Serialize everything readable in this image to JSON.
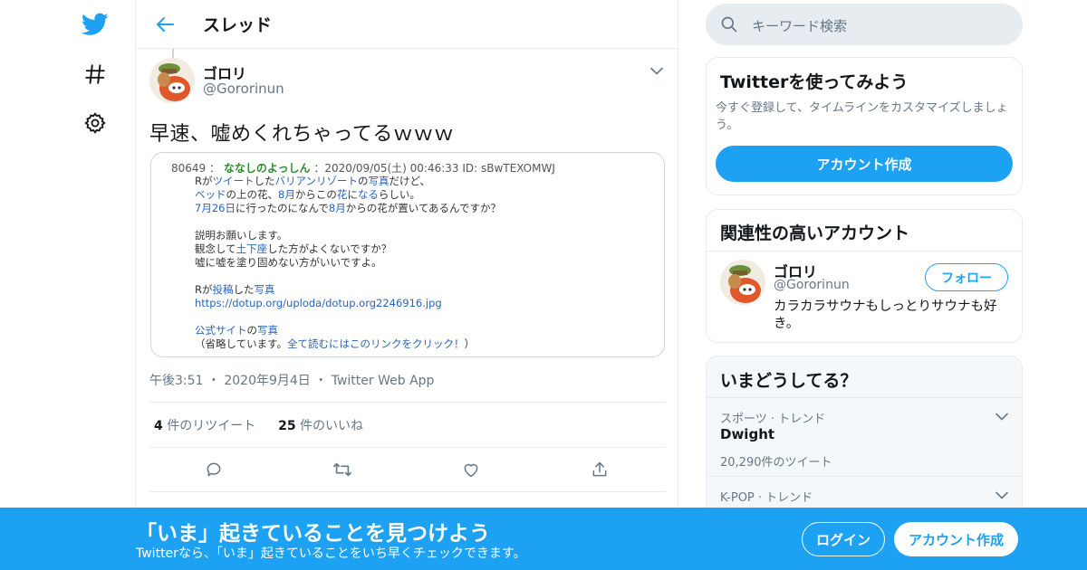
{
  "colors": {
    "accent": "#1da1f2",
    "text": "#14171a",
    "muted": "#657786",
    "border": "#e6ecf0",
    "link": "#2a64b8",
    "name_green": "#2e8b2e"
  },
  "nav": {
    "icons": [
      "twitter-bird-icon",
      "hashtag-icon",
      "gear-icon"
    ]
  },
  "header": {
    "title": "スレッド"
  },
  "tweet": {
    "author_name": "ゴロリ",
    "author_handle": "@Gororinun",
    "text": "早速、嘘めくれちゃってるｗｗｗ",
    "media": {
      "head_no": "80649 ：",
      "head_name": "ななしのよっしん",
      "head_meta": "：2020/09/05(土) 00:46:33 ID: sBwTEXOMWJ",
      "lines": [
        [
          "Rが",
          "ツイート",
          "した",
          "バリアンリゾート",
          "の",
          "写真",
          "だけど、"
        ],
        [
          "ベッド",
          "の上の花、",
          "8月",
          "からこの",
          "花",
          "に",
          "なる",
          "らしい。"
        ],
        [
          "7月26日",
          "に行ったのになんで",
          "8月",
          "からの花が置いてあるんですか？"
        ],
        [
          "説明お願いします。"
        ],
        [
          "観念して",
          "土下座",
          "した方がよくないですか？"
        ],
        [
          "嘘に嘘を塗り固めない方がいいですよ。"
        ],
        [
          "Rが",
          "投稿",
          "した",
          "写真"
        ],
        [
          "https://dotup.org/uploda/dotup.org2246916.jpg"
        ],
        [
          "公式サイト",
          "の",
          "写真"
        ],
        [
          "（省略しています。",
          "全て読むにはこのリンクをクリック！",
          "）"
        ]
      ]
    },
    "time": "午後3:51",
    "date": "2020年9月4日",
    "client": "Twitter Web App",
    "sep": "・",
    "retweet_count": "4",
    "retweet_label": "件のリツイート",
    "like_count": "25",
    "like_label": "件のいいね"
  },
  "search": {
    "placeholder": "キーワード検索"
  },
  "signup_card": {
    "title": "Twitterを使ってみよう",
    "desc": "今すぐ登録して、タイムラインをカスタマイズしましょう。",
    "button": "アカウント作成"
  },
  "related_card": {
    "title": "関連性の高いアカウント",
    "name": "ゴロリ",
    "handle": "@Gororinun",
    "follow": "フォロー",
    "bio": "カラカラサウナもしっとりサウナも好き。"
  },
  "trends_card": {
    "title": "いまどうしてる？",
    "items": [
      {
        "category": "スポーツ · トレンド",
        "name": "Dwight",
        "count": "20,290件のツイート"
      },
      {
        "category": "K-POP · トレンド",
        "name": "",
        "count": ""
      }
    ]
  },
  "banner": {
    "title": "「いま」起きていることを見つけよう",
    "subtitle": "Twitterなら、「いま」起きていることをいち早くチェックできます。",
    "login": "ログイン",
    "signup": "アカウント作成"
  }
}
